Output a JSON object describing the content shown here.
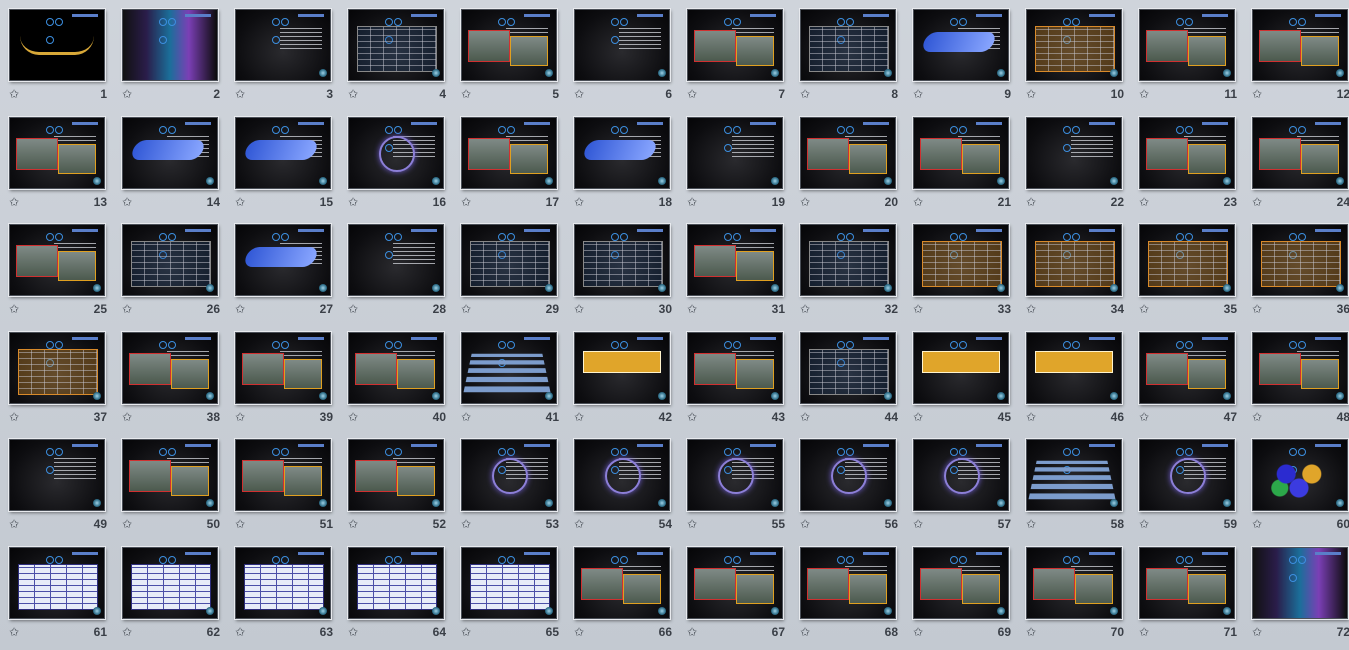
{
  "view": "slide-sorter",
  "colors": {
    "background": "#c7cdd5",
    "slide_bg": "#0d0d10",
    "number": "#3a3f47"
  },
  "transition_icon": "star-transition-icon",
  "transition_glyph": "✩",
  "slides": [
    {
      "number": "1",
      "variant": "title"
    },
    {
      "number": "2",
      "variant": "cover"
    },
    {
      "number": "3",
      "variant": "text"
    },
    {
      "number": "4",
      "variant": "table"
    },
    {
      "number": "5",
      "variant": "photo"
    },
    {
      "number": "6",
      "variant": "text"
    },
    {
      "number": "7",
      "variant": "photo"
    },
    {
      "number": "8",
      "variant": "table"
    },
    {
      "number": "9",
      "variant": "diagram"
    },
    {
      "number": "10",
      "variant": "orange"
    },
    {
      "number": "11",
      "variant": "photo"
    },
    {
      "number": "12",
      "variant": "photo"
    },
    {
      "number": "13",
      "variant": "photo"
    },
    {
      "number": "14",
      "variant": "diagram"
    },
    {
      "number": "15",
      "variant": "diagram"
    },
    {
      "number": "16",
      "variant": "circle"
    },
    {
      "number": "17",
      "variant": "photo"
    },
    {
      "number": "18",
      "variant": "diagram"
    },
    {
      "number": "19",
      "variant": "text"
    },
    {
      "number": "20",
      "variant": "photo"
    },
    {
      "number": "21",
      "variant": "photo"
    },
    {
      "number": "22",
      "variant": "text"
    },
    {
      "number": "23",
      "variant": "photo"
    },
    {
      "number": "24",
      "variant": "photo"
    },
    {
      "number": "25",
      "variant": "photo"
    },
    {
      "number": "26",
      "variant": "table"
    },
    {
      "number": "27",
      "variant": "diagram"
    },
    {
      "number": "28",
      "variant": "text"
    },
    {
      "number": "29",
      "variant": "table"
    },
    {
      "number": "30",
      "variant": "table"
    },
    {
      "number": "31",
      "variant": "photo"
    },
    {
      "number": "32",
      "variant": "table"
    },
    {
      "number": "33",
      "variant": "orange"
    },
    {
      "number": "34",
      "variant": "orange"
    },
    {
      "number": "35",
      "variant": "orange"
    },
    {
      "number": "36",
      "variant": "orange"
    },
    {
      "number": "37",
      "variant": "orange"
    },
    {
      "number": "38",
      "variant": "photo"
    },
    {
      "number": "39",
      "variant": "photo"
    },
    {
      "number": "40",
      "variant": "photo"
    },
    {
      "number": "41",
      "variant": "stairs"
    },
    {
      "number": "42",
      "variant": "gold"
    },
    {
      "number": "43",
      "variant": "photo"
    },
    {
      "number": "44",
      "variant": "table"
    },
    {
      "number": "45",
      "variant": "gold"
    },
    {
      "number": "46",
      "variant": "gold"
    },
    {
      "number": "47",
      "variant": "photo"
    },
    {
      "number": "48",
      "variant": "photo"
    },
    {
      "number": "49",
      "variant": "text"
    },
    {
      "number": "50",
      "variant": "photo"
    },
    {
      "number": "51",
      "variant": "photo"
    },
    {
      "number": "52",
      "variant": "photo"
    },
    {
      "number": "53",
      "variant": "circle"
    },
    {
      "number": "54",
      "variant": "circle"
    },
    {
      "number": "55",
      "variant": "circle"
    },
    {
      "number": "56",
      "variant": "circle"
    },
    {
      "number": "57",
      "variant": "circle"
    },
    {
      "number": "58",
      "variant": "stairs"
    },
    {
      "number": "59",
      "variant": "circle"
    },
    {
      "number": "60",
      "variant": "hex"
    },
    {
      "number": "61",
      "variant": "bluetable"
    },
    {
      "number": "62",
      "variant": "bluetable"
    },
    {
      "number": "63",
      "variant": "bluetable"
    },
    {
      "number": "64",
      "variant": "bluetable"
    },
    {
      "number": "65",
      "variant": "bluetable"
    },
    {
      "number": "66",
      "variant": "photo"
    },
    {
      "number": "67",
      "variant": "photo"
    },
    {
      "number": "68",
      "variant": "photo"
    },
    {
      "number": "69",
      "variant": "photo"
    },
    {
      "number": "70",
      "variant": "photo"
    },
    {
      "number": "71",
      "variant": "photo"
    },
    {
      "number": "72",
      "variant": "cover"
    }
  ]
}
